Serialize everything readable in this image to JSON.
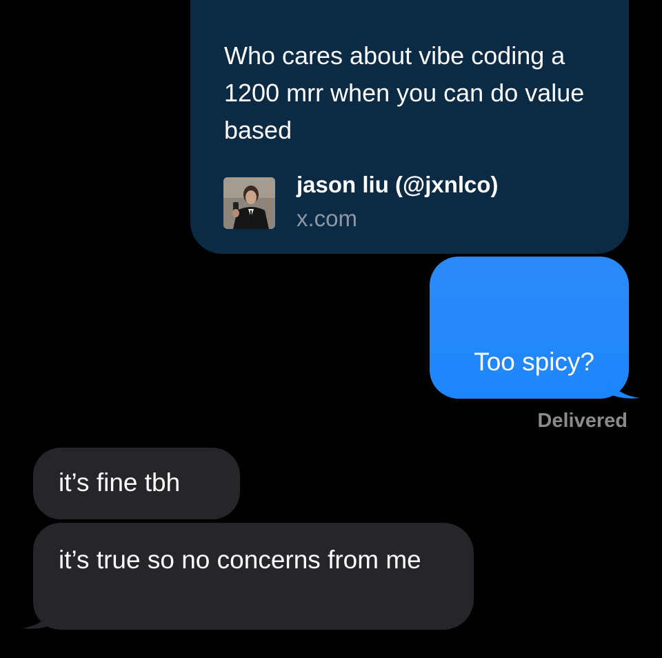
{
  "colors": {
    "background": "#000000",
    "link_card": "#0b2a44",
    "sent_bubble": "#1e86fd",
    "received_bubble": "#26262a",
    "receipt_text": "#8a8a8f",
    "domain_text": "#8e97a3"
  },
  "link_preview": {
    "headline": "Who cares about vibe coding a 1200 mrr when you can do value based",
    "author": "jason liu (@jxnlco)",
    "domain": "x.com",
    "avatar_icon": "profile-photo"
  },
  "messages": {
    "sent": [
      {
        "text": "Too spicy?"
      }
    ],
    "receipt": "Delivered",
    "received": [
      {
        "text": "it’s fine tbh"
      },
      {
        "text": "it’s true so no concerns from me"
      }
    ]
  }
}
